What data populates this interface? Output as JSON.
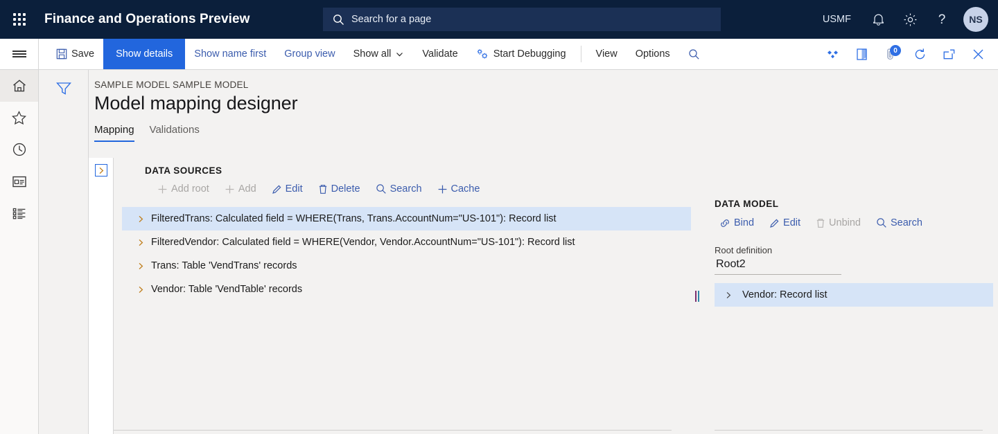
{
  "header": {
    "waffle_name": "app-launcher",
    "title": "Finance and Operations Preview",
    "search_placeholder": "Search for a page",
    "company": "USMF",
    "avatar_initials": "NS",
    "bg_color": "#0b1f3b"
  },
  "command_bar": {
    "save_label": "Save",
    "show_details_label": "Show details",
    "show_name_first_label": "Show name first",
    "group_view_label": "Group view",
    "show_all_label": "Show all",
    "validate_label": "Validate",
    "start_debugging_label": "Start Debugging",
    "view_label": "View",
    "options_label": "Options",
    "notification_count": "0",
    "active_accent": "#2266dd"
  },
  "nav_rail": {
    "items": [
      {
        "icon": "home-icon",
        "selected": true
      },
      {
        "icon": "star-icon",
        "selected": false
      },
      {
        "icon": "clock-icon",
        "selected": false
      },
      {
        "icon": "workspace-icon",
        "selected": false
      },
      {
        "icon": "list-icon",
        "selected": false
      }
    ]
  },
  "page": {
    "breadcrumb": "SAMPLE MODEL SAMPLE MODEL",
    "title": "Model mapping designer",
    "tabs": [
      {
        "label": "Mapping",
        "active": true
      },
      {
        "label": "Validations",
        "active": false
      }
    ]
  },
  "data_sources": {
    "section_title": "DATA SOURCES",
    "toolbar": [
      {
        "label": "Add root",
        "icon": "plus-icon",
        "disabled": true
      },
      {
        "label": "Add",
        "icon": "plus-icon",
        "disabled": true
      },
      {
        "label": "Edit",
        "icon": "pencil-icon",
        "disabled": false
      },
      {
        "label": "Delete",
        "icon": "trash-icon",
        "disabled": false
      },
      {
        "label": "Search",
        "icon": "search-icon",
        "disabled": false
      },
      {
        "label": "Cache",
        "icon": "plus-icon",
        "disabled": false
      }
    ],
    "rows": [
      {
        "label": "FilteredTrans: Calculated field = WHERE(Trans, Trans.AccountNum=\"US-101\"): Record list",
        "selected": true
      },
      {
        "label": "FilteredVendor: Calculated field = WHERE(Vendor, Vendor.AccountNum=\"US-101\"): Record list",
        "selected": false
      },
      {
        "label": "Trans: Table 'VendTrans' records",
        "selected": false
      },
      {
        "label": "Vendor: Table 'VendTable' records",
        "selected": false
      }
    ]
  },
  "data_model": {
    "section_title": "DATA MODEL",
    "toolbar": [
      {
        "label": "Bind",
        "icon": "link-icon",
        "disabled": false
      },
      {
        "label": "Edit",
        "icon": "pencil-icon",
        "disabled": false
      },
      {
        "label": "Unbind",
        "icon": "trash-icon",
        "disabled": true
      },
      {
        "label": "Search",
        "icon": "search-icon",
        "disabled": false
      }
    ],
    "root_definition_label": "Root definition",
    "root_definition_value": "Root2",
    "rows": [
      {
        "label": "Vendor: Record list",
        "selected": true
      }
    ]
  },
  "colors": {
    "selection": "#d6e4f7",
    "link": "#3b5cad",
    "panel_bg": "#f3f2f1"
  }
}
